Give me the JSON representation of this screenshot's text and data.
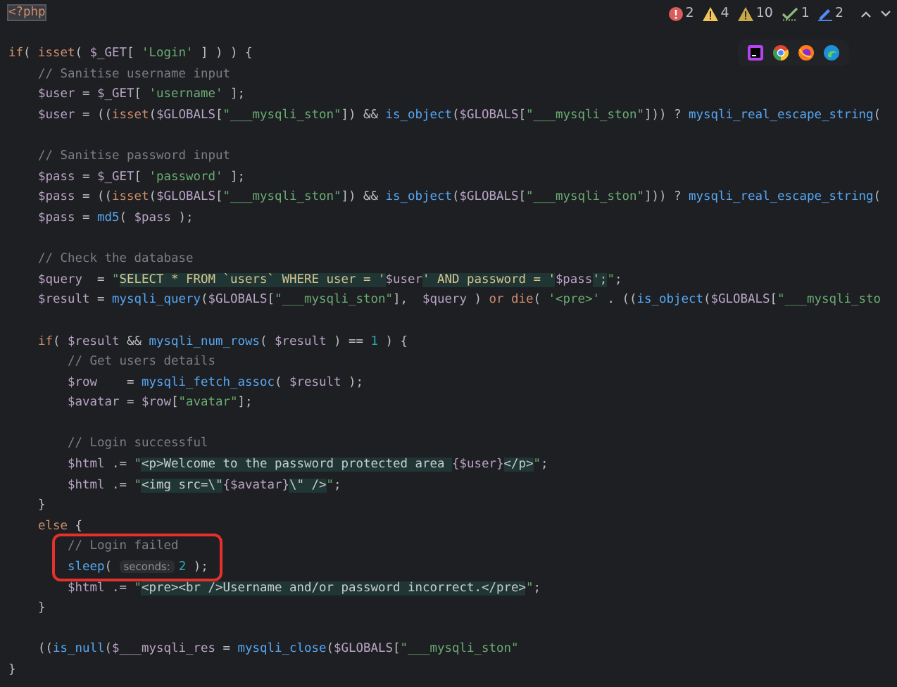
{
  "inspections": [
    {
      "kind": "error",
      "count": "2"
    },
    {
      "kind": "warning",
      "count": "4"
    },
    {
      "kind": "weak_warning",
      "count": "10"
    },
    {
      "kind": "typo",
      "count": "1"
    },
    {
      "kind": "edit",
      "count": "2"
    }
  ],
  "code": {
    "lines": [
      {
        "boxed": false,
        "tokens": [
          {
            "kind": "tag",
            "text": "<?php"
          }
        ]
      },
      {
        "boxed": false
      },
      {
        "boxed": false,
        "tokens": [
          {
            "kind": "kw",
            "text": "if"
          },
          {
            "kind": "plain",
            "text": "( "
          },
          {
            "kind": "kw",
            "text": "isset"
          },
          {
            "kind": "plain",
            "text": "( "
          },
          {
            "kind": "var",
            "text": "$_GET"
          },
          {
            "kind": "plain",
            "text": "[ "
          },
          {
            "kind": "str",
            "text": "'Login'"
          },
          {
            "kind": "plain",
            "text": " ] ) ) {"
          }
        ]
      },
      {
        "boxed": false,
        "tokens": [
          {
            "kind": "comment",
            "text": "    // Sanitise username input"
          }
        ]
      },
      {
        "boxed": false,
        "tokens": [
          {
            "kind": "var",
            "text": "    $user"
          },
          {
            "kind": "plain",
            "text": " = "
          },
          {
            "kind": "var",
            "text": "$_GET"
          },
          {
            "kind": "plain",
            "text": "[ "
          },
          {
            "kind": "str",
            "text": "'username'"
          },
          {
            "kind": "plain",
            "text": " ];"
          }
        ]
      },
      {
        "boxed": false,
        "tokens": [
          {
            "kind": "var",
            "text": "    $user"
          },
          {
            "kind": "plain",
            "text": " = (("
          },
          {
            "kind": "kw",
            "text": "isset"
          },
          {
            "kind": "plain",
            "text": "("
          },
          {
            "kind": "var",
            "text": "$GLOBALS"
          },
          {
            "kind": "plain",
            "text": "["
          },
          {
            "kind": "str",
            "text": "\"___mysqli_ston\""
          },
          {
            "kind": "plain",
            "text": "]) && "
          },
          {
            "kind": "fn",
            "text": "is_object"
          },
          {
            "kind": "plain",
            "text": "("
          },
          {
            "kind": "var",
            "text": "$GLOBALS"
          },
          {
            "kind": "plain",
            "text": "["
          },
          {
            "kind": "str",
            "text": "\"___mysqli_ston\""
          },
          {
            "kind": "plain",
            "text": "])) ? "
          },
          {
            "kind": "fn",
            "text": "mysqli_real_escape_string"
          },
          {
            "kind": "plain",
            "text": "("
          }
        ]
      },
      {
        "boxed": false
      },
      {
        "boxed": false,
        "tokens": [
          {
            "kind": "comment",
            "text": "    // Sanitise password input"
          }
        ]
      },
      {
        "boxed": false,
        "tokens": [
          {
            "kind": "var",
            "text": "    $pass"
          },
          {
            "kind": "plain",
            "text": " = "
          },
          {
            "kind": "var",
            "text": "$_GET"
          },
          {
            "kind": "plain",
            "text": "[ "
          },
          {
            "kind": "str",
            "text": "'password'"
          },
          {
            "kind": "plain",
            "text": " ];"
          }
        ]
      },
      {
        "boxed": false,
        "tokens": [
          {
            "kind": "var",
            "text": "    $pass"
          },
          {
            "kind": "plain",
            "text": " = (("
          },
          {
            "kind": "kw",
            "text": "isset"
          },
          {
            "kind": "plain",
            "text": "("
          },
          {
            "kind": "var",
            "text": "$GLOBALS"
          },
          {
            "kind": "plain",
            "text": "["
          },
          {
            "kind": "str",
            "text": "\"___mysqli_ston\""
          },
          {
            "kind": "plain",
            "text": "]) && "
          },
          {
            "kind": "fn",
            "text": "is_object"
          },
          {
            "kind": "plain",
            "text": "("
          },
          {
            "kind": "var",
            "text": "$GLOBALS"
          },
          {
            "kind": "plain",
            "text": "["
          },
          {
            "kind": "str",
            "text": "\"___mysqli_ston\""
          },
          {
            "kind": "plain",
            "text": "])) ? "
          },
          {
            "kind": "fn",
            "text": "mysqli_real_escape_string"
          },
          {
            "kind": "plain",
            "text": "("
          }
        ]
      },
      {
        "boxed": false,
        "tokens": [
          {
            "kind": "var",
            "text": "    $pass"
          },
          {
            "kind": "plain",
            "text": " = "
          },
          {
            "kind": "fn",
            "text": "md5"
          },
          {
            "kind": "plain",
            "text": "( "
          },
          {
            "kind": "var",
            "text": "$pass"
          },
          {
            "kind": "plain",
            "text": " );"
          }
        ]
      },
      {
        "boxed": false
      },
      {
        "boxed": false,
        "tokens": [
          {
            "kind": "comment",
            "text": "    // Check the database"
          }
        ]
      },
      {
        "boxed": false,
        "tokens": [
          {
            "kind": "var",
            "text": "    $query"
          },
          {
            "kind": "plain",
            "text": "  = "
          },
          {
            "kind": "str",
            "text": "\""
          },
          {
            "kind": "sql",
            "text": "SELECT * FROM `users` WHERE user = '"
          },
          {
            "kind": "var",
            "text": "$user"
          },
          {
            "kind": "sql",
            "text": "' AND password = '"
          },
          {
            "kind": "var",
            "text": "$pass"
          },
          {
            "kind": "sql",
            "text": "';"
          },
          {
            "kind": "str",
            "text": "\""
          },
          {
            "kind": "plain",
            "text": ";"
          }
        ]
      },
      {
        "boxed": false,
        "tokens": [
          {
            "kind": "var",
            "text": "    $result"
          },
          {
            "kind": "plain",
            "text": " = "
          },
          {
            "kind": "fn",
            "text": "mysqli_query"
          },
          {
            "kind": "plain",
            "text": "("
          },
          {
            "kind": "var",
            "text": "$GLOBALS"
          },
          {
            "kind": "plain",
            "text": "["
          },
          {
            "kind": "str",
            "text": "\"___mysqli_ston\""
          },
          {
            "kind": "plain",
            "text": "],  "
          },
          {
            "kind": "var",
            "text": "$query"
          },
          {
            "kind": "plain",
            "text": " ) "
          },
          {
            "kind": "kw",
            "text": "or die"
          },
          {
            "kind": "plain",
            "text": "( "
          },
          {
            "kind": "str",
            "text": "'<pre>'"
          },
          {
            "kind": "plain",
            "text": " . (("
          },
          {
            "kind": "fn",
            "text": "is_object"
          },
          {
            "kind": "plain",
            "text": "("
          },
          {
            "kind": "var",
            "text": "$GLOBALS"
          },
          {
            "kind": "plain",
            "text": "["
          },
          {
            "kind": "str",
            "text": "\"___mysqli_sto"
          }
        ]
      },
      {
        "boxed": false
      },
      {
        "boxed": false,
        "tokens": [
          {
            "kind": "kw",
            "text": "    if"
          },
          {
            "kind": "plain",
            "text": "( "
          },
          {
            "kind": "var",
            "text": "$result"
          },
          {
            "kind": "plain",
            "text": " && "
          },
          {
            "kind": "fn",
            "text": "mysqli_num_rows"
          },
          {
            "kind": "plain",
            "text": "( "
          },
          {
            "kind": "var",
            "text": "$result"
          },
          {
            "kind": "plain",
            "text": " ) == "
          },
          {
            "kind": "num",
            "text": "1"
          },
          {
            "kind": "plain",
            "text": " ) {"
          }
        ]
      },
      {
        "boxed": false,
        "tokens": [
          {
            "kind": "comment",
            "text": "        // Get users details"
          }
        ]
      },
      {
        "boxed": false,
        "tokens": [
          {
            "kind": "var",
            "text": "        $row"
          },
          {
            "kind": "plain",
            "text": "    = "
          },
          {
            "kind": "fn",
            "text": "mysqli_fetch_assoc"
          },
          {
            "kind": "plain",
            "text": "( "
          },
          {
            "kind": "var",
            "text": "$result"
          },
          {
            "kind": "plain",
            "text": " );"
          }
        ]
      },
      {
        "boxed": false,
        "tokens": [
          {
            "kind": "var",
            "text": "        $avatar"
          },
          {
            "kind": "plain",
            "text": " = "
          },
          {
            "kind": "var",
            "text": "$row"
          },
          {
            "kind": "plain",
            "text": "["
          },
          {
            "kind": "str",
            "text": "\"avatar\""
          },
          {
            "kind": "plain",
            "text": "];"
          }
        ]
      },
      {
        "boxed": false
      },
      {
        "boxed": false,
        "tokens": [
          {
            "kind": "comment",
            "text": "        // Login successful"
          }
        ]
      },
      {
        "boxed": false,
        "tokens": [
          {
            "kind": "var",
            "text": "        $html"
          },
          {
            "kind": "plain",
            "text": " .= "
          },
          {
            "kind": "str",
            "text": "\""
          },
          {
            "kind": "html",
            "text": "<p>Welcome to the password protected area "
          },
          {
            "kind": "var",
            "text": "{$user}"
          },
          {
            "kind": "html",
            "text": "</p>"
          },
          {
            "kind": "str",
            "text": "\""
          },
          {
            "kind": "plain",
            "text": ";"
          }
        ]
      },
      {
        "boxed": false,
        "tokens": [
          {
            "kind": "var",
            "text": "        $html"
          },
          {
            "kind": "plain",
            "text": " .= "
          },
          {
            "kind": "str",
            "text": "\""
          },
          {
            "kind": "html",
            "text": "<img src=\\\""
          },
          {
            "kind": "var",
            "text": "{$avatar}"
          },
          {
            "kind": "html",
            "text": "\\\" />"
          },
          {
            "kind": "str",
            "text": "\""
          },
          {
            "kind": "plain",
            "text": ";"
          }
        ]
      },
      {
        "boxed": false,
        "tokens": [
          {
            "kind": "plain",
            "text": "    }"
          }
        ]
      },
      {
        "boxed": false,
        "tokens": [
          {
            "kind": "kw",
            "text": "    else"
          },
          {
            "kind": "plain",
            "text": " {"
          }
        ]
      },
      {
        "boxed": true,
        "tokens": [
          {
            "kind": "comment",
            "text": "        // Login failed"
          }
        ]
      },
      {
        "boxed": true,
        "tokens": [
          {
            "kind": "fn",
            "text": "        sleep"
          },
          {
            "kind": "plain",
            "text": "( "
          },
          {
            "kind": "hint",
            "text": "seconds:"
          },
          {
            "kind": "num",
            "text": "2"
          },
          {
            "kind": "plain",
            "text": " );"
          }
        ]
      },
      {
        "boxed": false,
        "tokens": [
          {
            "kind": "var",
            "text": "        $html"
          },
          {
            "kind": "plain",
            "text": " .= "
          },
          {
            "kind": "str",
            "text": "\""
          },
          {
            "kind": "html",
            "text": "<pre><br />Username and/or password incorrect.</pre>"
          },
          {
            "kind": "str",
            "text": "\""
          },
          {
            "kind": "plain",
            "text": ";"
          }
        ]
      },
      {
        "boxed": false,
        "tokens": [
          {
            "kind": "plain",
            "text": "    }"
          }
        ]
      },
      {
        "boxed": false
      },
      {
        "boxed": false,
        "tokens": [
          {
            "kind": "plain",
            "text": "    (("
          },
          {
            "kind": "fn",
            "text": "is_null"
          },
          {
            "kind": "plain",
            "text": "("
          },
          {
            "kind": "var",
            "text": "$___mysqli_res"
          },
          {
            "kind": "plain",
            "text": " = "
          },
          {
            "kind": "fn",
            "text": "mysqli_close"
          },
          {
            "kind": "plain",
            "text": "("
          },
          {
            "kind": "var",
            "text": "$GLOBALS"
          },
          {
            "kind": "plain",
            "text": "["
          },
          {
            "kind": "str",
            "text": "\"___mysqli_ston\""
          }
        ]
      },
      {
        "boxed": false,
        "tokens": [
          {
            "kind": "plain",
            "text": "}"
          }
        ]
      }
    ]
  }
}
